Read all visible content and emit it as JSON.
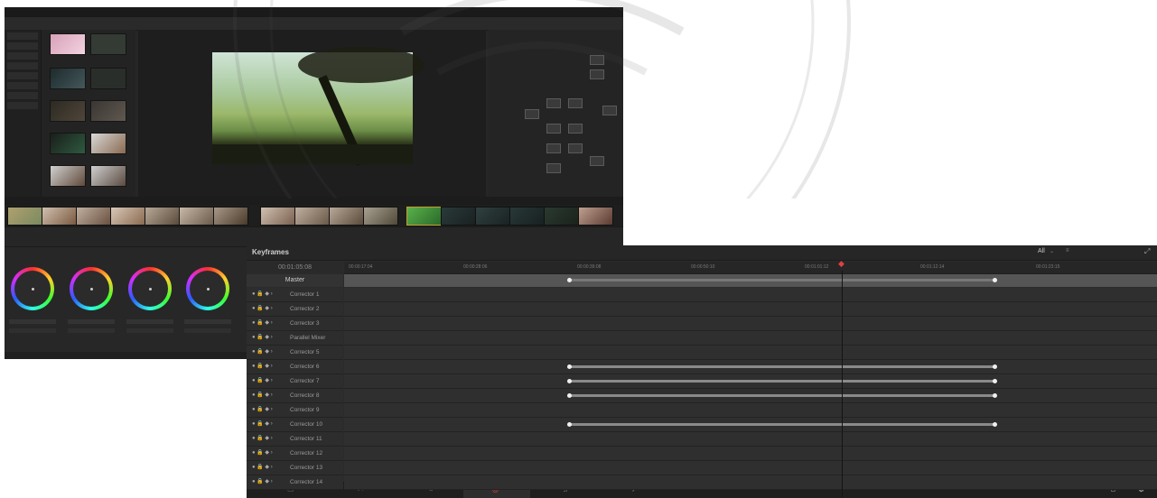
{
  "keyframes": {
    "title": "Keyframes",
    "filter_label": "All",
    "filter_caret": "⌄",
    "settings_glyph": "≡",
    "expand_glyph": "⤢",
    "timecode": "00:01:05:08",
    "ruler_ticks": [
      "00:00:17:04",
      "00:00:28:06",
      "00:00:39:08",
      "00:00:50:10",
      "00:01:01:12",
      "00:01:12:14",
      "00:01:23:15"
    ],
    "master_label": "Master",
    "tracks": [
      "Corrector 1",
      "Corrector 2",
      "Corrector 3",
      "Parallel Mixer",
      "Corrector 5",
      "Corrector 6",
      "Corrector 7",
      "Corrector 8",
      "Corrector 9",
      "Corrector 10",
      "Corrector 11",
      "Corrector 12",
      "Corrector 13",
      "Corrector 14"
    ],
    "track_controls": "●  🔒  ◆  ›"
  },
  "nav": {
    "icons": [
      "media-icon",
      "cut-icon",
      "edit-icon",
      "color-icon",
      "fairlight-icon",
      "deliver-icon",
      "home-icon",
      "settings-icon"
    ],
    "glyphs": [
      "▭",
      "✂",
      "✎",
      "◎",
      "♫",
      "✈",
      "⌂",
      "⚙"
    ]
  },
  "colors": {
    "accent_playhead": "#e04040",
    "panel_bg": "#2b2b2b",
    "keyframe_dot": "#f0f0f0"
  }
}
